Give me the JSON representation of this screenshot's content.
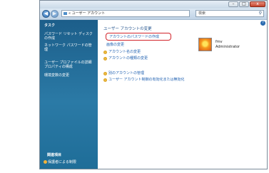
{
  "window": {
    "address_path": "« ユーザー アカウント",
    "search_placeholder": "検索",
    "controls": {
      "minimize": "–",
      "maximize": "□",
      "close": "x"
    }
  },
  "sidebar": {
    "task_title": "タスク",
    "tasks": [
      "パスワード リセット ディスク\nの作成",
      "ネットワーク パスワードの管\n理",
      "ユーザー プロファイルの詳細\nプロパティの構成",
      "環境変数の変更"
    ],
    "related_title": "関連項目",
    "related_items": [
      "保護者による制限"
    ]
  },
  "main": {
    "heading": "ユーザー アカウントの変更",
    "links": [
      "アカウントのパスワードの作成",
      "画像の変更",
      "アカウント名の変更",
      "アカウントの種類の変更"
    ],
    "other_links": [
      "別のアカウントの管理",
      "ユーザー アカウント制御の有効化または無効化"
    ],
    "user": {
      "name": "fmv",
      "role": "Administrator"
    }
  },
  "colors": {
    "sidebar": "#2b7aa6",
    "link": "#1d5fb0",
    "highlight": "#d2232a"
  }
}
